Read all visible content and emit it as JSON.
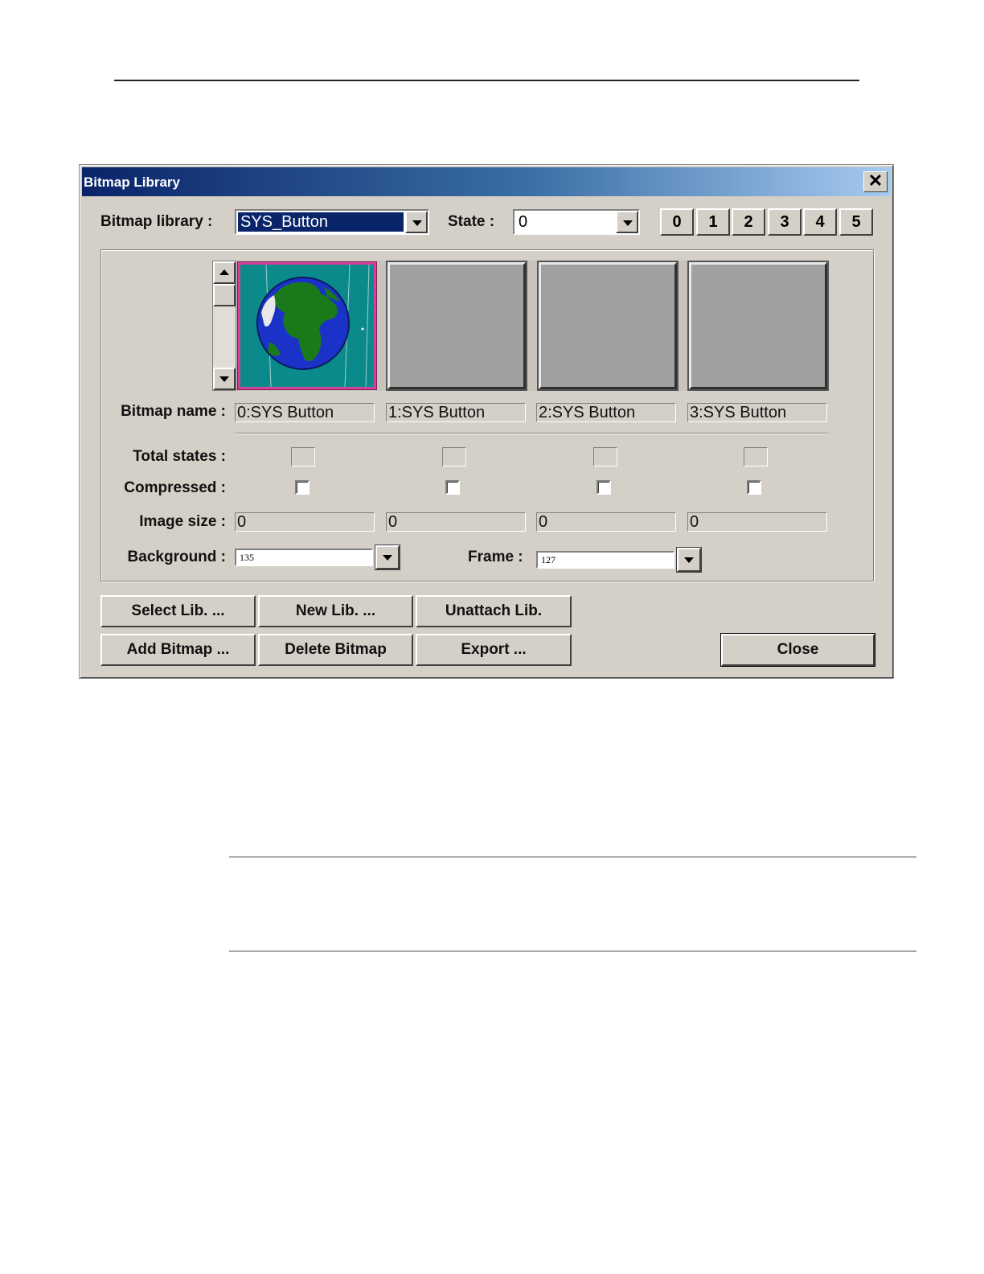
{
  "dialog": {
    "title": "Bitmap Library",
    "close_glyph": "✕",
    "library_label": "Bitmap library :",
    "library_value": "SYS_Button",
    "state_label": "State :",
    "state_value": "0",
    "state_buttons": [
      "0",
      "1",
      "2",
      "3",
      "4",
      "5"
    ],
    "bitmap_name_label": "Bitmap name :",
    "bitmaps": [
      {
        "name": "0:SYS  Button",
        "image_size": "0",
        "icon": "globe-icon",
        "selected": true
      },
      {
        "name": "1:SYS  Button",
        "image_size": "0",
        "icon": "blank",
        "selected": false
      },
      {
        "name": "2:SYS  Button",
        "image_size": "0",
        "icon": "blank",
        "selected": false
      },
      {
        "name": "3:SYS  Button",
        "image_size": "0",
        "icon": "blank",
        "selected": false
      }
    ],
    "total_states_label": "Total states :",
    "compressed_label": "Compressed :",
    "image_size_label": "Image size :",
    "background_label": "Background :",
    "background_value": "135",
    "frame_label": "Frame :",
    "frame_value": "127",
    "buttons": {
      "select_lib": "Select Lib. ...",
      "new_lib": "New Lib. ...",
      "unattach_lib": "Unattach Lib.",
      "add_bitmap": "Add Bitmap ...",
      "delete_bitmap": "Delete Bitmap",
      "export": "Export ...",
      "close": "Close"
    },
    "colors": {
      "selection": "#0a246a",
      "tile_selected_border": "#d4409a",
      "face": "#d4d0c8"
    }
  }
}
